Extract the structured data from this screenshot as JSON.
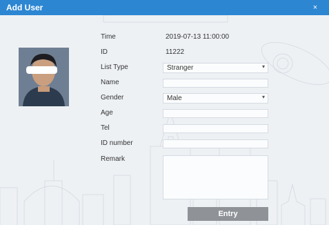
{
  "window": {
    "title": "Add User",
    "close_symbol": "×"
  },
  "photo": {
    "alt_icon": "face-photo"
  },
  "form": {
    "time": {
      "label": "Time",
      "value": "2019-07-13 11:00:00"
    },
    "id": {
      "label": "ID",
      "value": "11222"
    },
    "list_type": {
      "label": "List Type",
      "value": "Stranger"
    },
    "name": {
      "label": "Name",
      "value": ""
    },
    "gender": {
      "label": "Gender",
      "value": "Male"
    },
    "age": {
      "label": "Age",
      "value": ""
    },
    "tel": {
      "label": "Tel",
      "value": ""
    },
    "id_number": {
      "label": "ID number",
      "value": ""
    },
    "remark": {
      "label": "Remark",
      "value": ""
    }
  },
  "actions": {
    "entry_label": "Entry"
  },
  "colors": {
    "titlebar": "#2c86d2",
    "button": "#8f9398"
  }
}
